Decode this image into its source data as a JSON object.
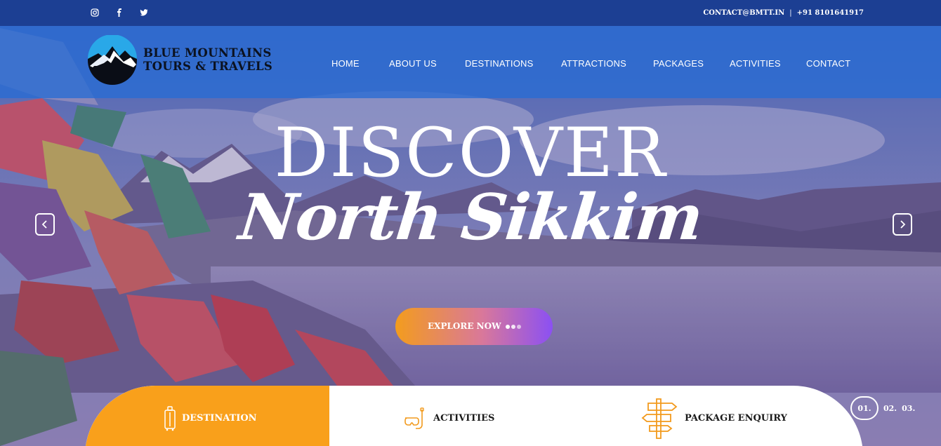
{
  "topbar": {
    "social": [
      {
        "name": "instagram-icon"
      },
      {
        "name": "facebook-icon"
      },
      {
        "name": "twitter-icon"
      }
    ],
    "email": "CONTACT@BMTT.IN",
    "separator": "|",
    "phone": "+91 8101641917"
  },
  "header": {
    "logo_line1": "BLUE MOUNTAINS",
    "logo_line2": "TOURS & TRAVELS",
    "nav": [
      "HOME",
      "ABOUT US",
      "DESTINATIONS",
      "ATTRACTIONS",
      "PACKAGES",
      "ACTIVITIES",
      "CONTACT"
    ]
  },
  "hero": {
    "title": "DISCOVER",
    "subtitle": "North Sikkim",
    "cta": "EXPLORE NOW"
  },
  "tabs": {
    "destination": "DESTINATION",
    "activities": "ACTIVITIES",
    "package_enquiry": "PACKAGE ENQUIRY"
  },
  "slider": {
    "current": "01.",
    "others": [
      "02.",
      "03."
    ]
  },
  "colors": {
    "topbar": "#1c3f93",
    "header": "#286cd4",
    "accent_orange": "#f9a01b",
    "accent_purple": "#8b50f3"
  }
}
